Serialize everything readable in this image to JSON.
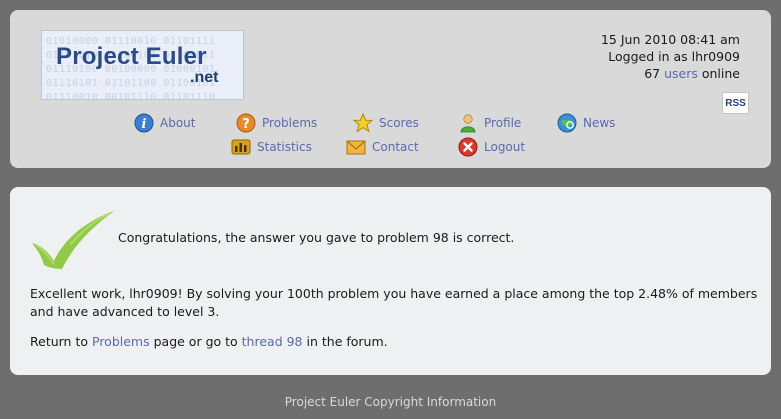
{
  "logo": {
    "name": "Project Euler",
    "tld": ".net",
    "binary_pattern": "01010000 01110010 01101111\n01101010 01100101 01100011\n01110100 00100000 01000101\n01110101 01101100 01100101\n01110010 00101110 01101110"
  },
  "status": {
    "datetime": "15 Jun 2010 08:41 am",
    "logged_in_prefix": "Logged in as",
    "username": "lhr0909",
    "users_count": "67",
    "users_link": "users",
    "online_suffix": "online"
  },
  "rss": {
    "label": "RSS"
  },
  "nav": {
    "about": "About",
    "problems": "Problems",
    "scores": "Scores",
    "profile": "Profile",
    "news": "News",
    "statistics": "Statistics",
    "contact": "Contact",
    "logout": "Logout"
  },
  "content": {
    "congrats": "Congratulations, the answer you gave to problem 98 is correct.",
    "excellent": "Excellent work, lhr0909! By solving your 100th problem you have earned a place among the top 2.48% of members and have advanced to level 3.",
    "return_prefix": "Return to",
    "problems_link": "Problems",
    "return_mid": "page or go to",
    "thread_link": "thread 98",
    "return_suffix": "in the forum."
  },
  "footer": {
    "text": "Project Euler Copyright Information"
  },
  "colors": {
    "background": "#6e6e6e",
    "header_panel": "#d9d9d9",
    "content_panel": "#eff0f2",
    "link": "#5a6aa8",
    "check_green": "#8cc63f"
  }
}
